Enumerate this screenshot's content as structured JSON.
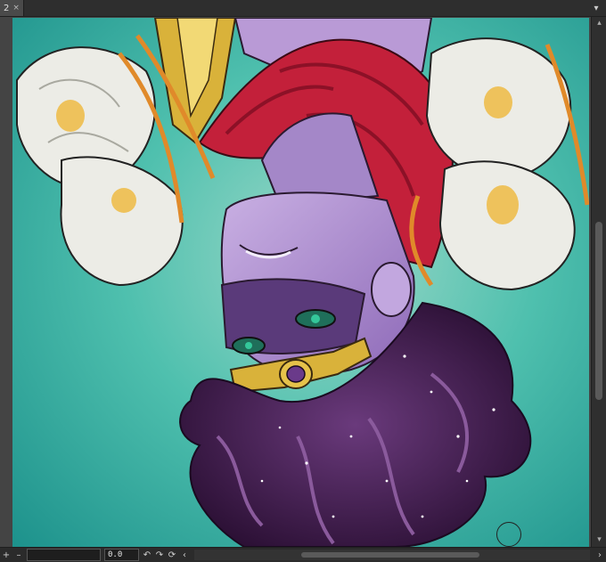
{
  "tab": {
    "label": "2",
    "close_glyph": "×"
  },
  "tab_menu_glyph": "▾",
  "status_bar": {
    "zoom_value": "",
    "angle_value": "0.0",
    "buttons": [
      "+",
      "–",
      "↶",
      "↷",
      "⟳",
      "‹"
    ]
  },
  "scrollbar_glyphs": {
    "up": "▴",
    "down": "▾",
    "left": "‹",
    "right": "›"
  },
  "colors": {
    "background_teal": "#3fb3a4",
    "skin_purple": "#b99ad6",
    "cloth_red": "#c3203a",
    "gold": "#d9b23a",
    "hair_purple": "#4a2456",
    "flower_white": "#ecece6"
  }
}
